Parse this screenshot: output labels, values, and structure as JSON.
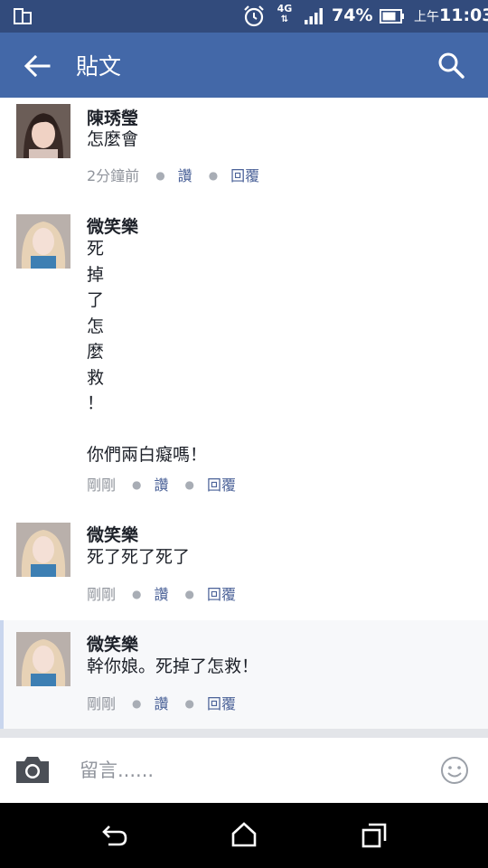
{
  "status_bar": {
    "network": "4G",
    "battery": "74%",
    "time_ampm": "上午",
    "time": "11:03"
  },
  "app_bar": {
    "title": "貼文"
  },
  "comments": [
    {
      "name": "陳琇瑩",
      "text": "怎麼會",
      "time": "2分鐘前",
      "like": "讚",
      "reply": "回覆"
    },
    {
      "name": "微笑樂",
      "text": "死\n掉\n了\n怎\n麼\n救\n！\n\n你們兩白癡嗎！",
      "time": "剛剛",
      "like": "讚",
      "reply": "回覆"
    },
    {
      "name": "微笑樂",
      "text": "死了死了死了",
      "time": "剛剛",
      "like": "讚",
      "reply": "回覆"
    },
    {
      "name": "微笑樂",
      "text": "幹你娘。死掉了怎救！",
      "time": "剛剛",
      "like": "讚",
      "reply": "回覆"
    }
  ],
  "composer": {
    "placeholder": "留言......"
  },
  "colors": {
    "status_bar": "#324b7c",
    "app_bar": "#4368a8",
    "action_link": "#4b6298"
  }
}
